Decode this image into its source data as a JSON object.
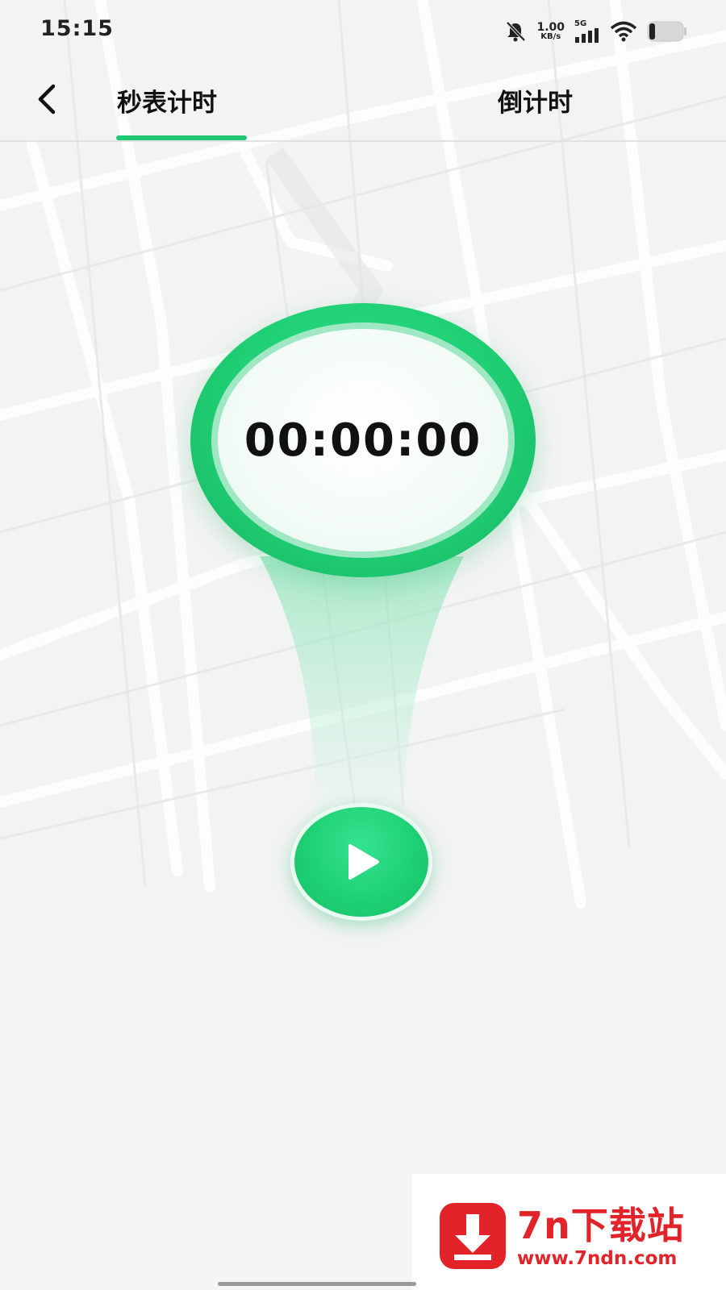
{
  "status_bar": {
    "time": "15:15",
    "net_speed_value": "1.00",
    "net_speed_unit": "KB/s",
    "network_type": "5G",
    "icons": [
      "bell-mute-icon",
      "signal-icon",
      "wifi-icon",
      "battery-icon"
    ]
  },
  "header": {
    "tabs": [
      {
        "label": "秒表计时",
        "active": true
      },
      {
        "label": "倒计时",
        "active": false
      }
    ]
  },
  "timer": {
    "display": "00:00:00"
  },
  "watermark": {
    "name": "7n下载站",
    "url": "www.7ndn.com"
  },
  "colors": {
    "accent": "#1ec774",
    "accent_dark": "#17b463",
    "watermark_red": "#e2242a"
  }
}
